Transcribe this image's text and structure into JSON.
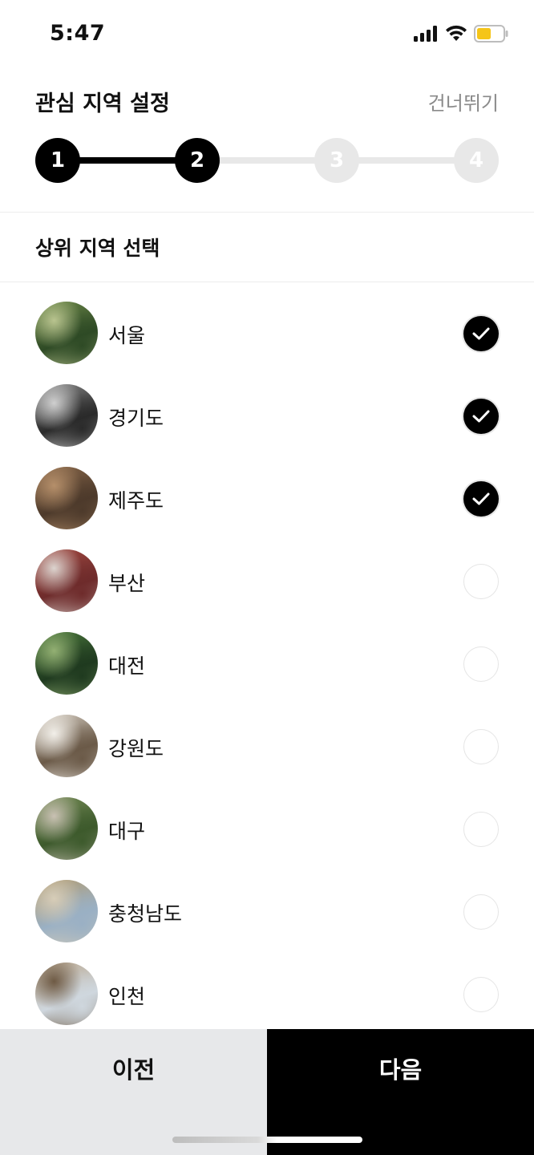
{
  "status_bar": {
    "time": "5:47",
    "battery_color": "#f5c518"
  },
  "header": {
    "title": "관심 지역 설정",
    "skip_label": "건너뛰기"
  },
  "stepper": {
    "current_step": 2,
    "steps": [
      "1",
      "2",
      "3",
      "4"
    ]
  },
  "section": {
    "title": "상위 지역 선택"
  },
  "regions": [
    {
      "name": "서울",
      "selected": true,
      "thumb_icon": "forest-cabin-photo",
      "colors": [
        "#2e4a25",
        "#6f8a4a",
        "#b9c48f"
      ]
    },
    {
      "name": "경기도",
      "selected": true,
      "thumb_icon": "interior-window-photo",
      "colors": [
        "#2a2a2a",
        "#8e8e8e",
        "#cfcfcf"
      ]
    },
    {
      "name": "제주도",
      "selected": true,
      "thumb_icon": "tree-forest-photo",
      "colors": [
        "#4d3a2b",
        "#8c6a4c",
        "#b58f6a"
      ]
    },
    {
      "name": "부산",
      "selected": false,
      "thumb_icon": "red-barn-house-photo",
      "colors": [
        "#6e2b2b",
        "#a34a42",
        "#dcd4cf"
      ]
    },
    {
      "name": "대전",
      "selected": false,
      "thumb_icon": "jungle-house-photo",
      "colors": [
        "#1f3a1f",
        "#4d7a3d",
        "#93b073"
      ]
    },
    {
      "name": "강원도",
      "selected": false,
      "thumb_icon": "bedroom-photo",
      "colors": [
        "#6b5a48",
        "#d8d1c6",
        "#f2efe9"
      ]
    },
    {
      "name": "대구",
      "selected": false,
      "thumb_icon": "garden-cabin-photo",
      "colors": [
        "#3d5a2c",
        "#7a8f5a",
        "#c9c1b3"
      ]
    },
    {
      "name": "충청남도",
      "selected": false,
      "thumb_icon": "glass-greenhouse-photo",
      "colors": [
        "#9ab0c4",
        "#b39a6c",
        "#d7cdb8"
      ]
    },
    {
      "name": "인천",
      "selected": false,
      "thumb_icon": "terrace-lounge-photo",
      "colors": [
        "#cfd7de",
        "#b8a48a",
        "#6e5a44"
      ]
    }
  ],
  "footer": {
    "prev_label": "이전",
    "next_label": "다음"
  }
}
